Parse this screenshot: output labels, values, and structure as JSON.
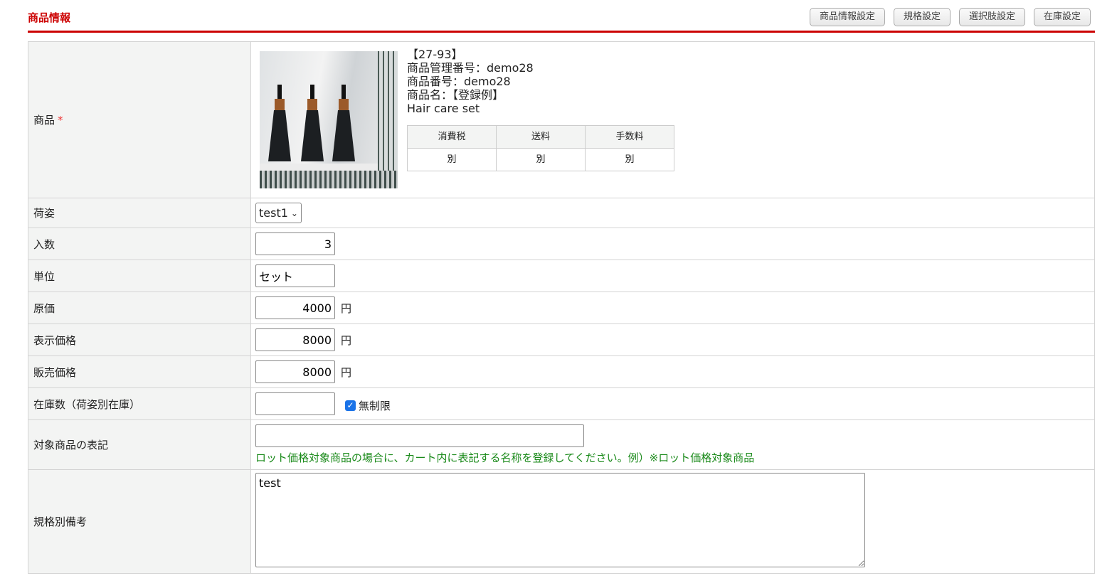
{
  "header": {
    "title": "商品情報",
    "buttons": [
      "商品情報設定",
      "規格設定",
      "選択肢設定",
      "在庫設定"
    ]
  },
  "product": {
    "label": "商品",
    "required_mark": "*",
    "code": "【27-93】",
    "mgmt_no": "商品管理番号：demo28",
    "item_no": "商品番号：demo28",
    "name": "商品名：【登録例】",
    "name2": "Hair care set",
    "fee_headers": [
      "消費税",
      "送料",
      "手数料"
    ],
    "fee_values": [
      "別",
      "別",
      "別"
    ]
  },
  "rows": {
    "packing": {
      "label": "荷姿",
      "value": "test1"
    },
    "quantity": {
      "label": "入数",
      "value": "3"
    },
    "unit": {
      "label": "単位",
      "value": "セット"
    },
    "cost": {
      "label": "原価",
      "value": "4000",
      "suffix": "円"
    },
    "display_price": {
      "label": "表示価格",
      "value": "8000",
      "suffix": "円"
    },
    "sale_price": {
      "label": "販売価格",
      "value": "8000",
      "suffix": "円"
    },
    "stock": {
      "label": "在庫数（荷姿別在庫）",
      "value": "",
      "unlimited_label": "無制限",
      "unlimited_checked": true
    },
    "target_label": {
      "label": "対象商品の表記",
      "value": "",
      "note": "ロット価格対象商品の場合に、カート内に表記する名称を登録してください。例）※ロット価格対象商品"
    },
    "remarks": {
      "label": "規格別備考",
      "value": "test"
    }
  }
}
